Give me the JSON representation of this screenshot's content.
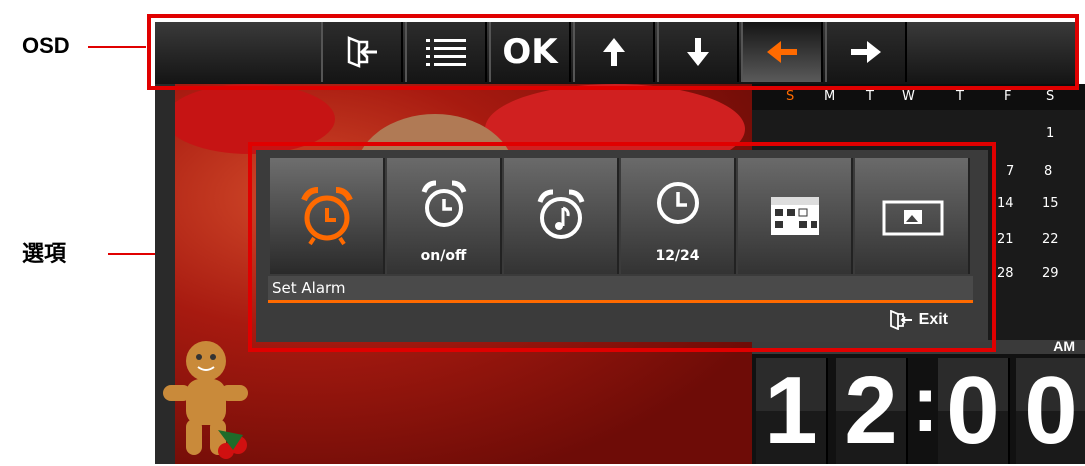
{
  "annotations": {
    "osd": "OSD",
    "options": "選項"
  },
  "osd": {
    "buttons": [
      {
        "name": "exit-icon",
        "glyph": "⇦"
      },
      {
        "name": "menu-list-icon",
        "glyph": "☰"
      },
      {
        "name": "ok",
        "label": "OK"
      },
      {
        "name": "arrow-up-icon",
        "glyph": "↑"
      },
      {
        "name": "arrow-down-icon",
        "glyph": "↓"
      },
      {
        "name": "arrow-left-icon",
        "glyph": "←",
        "active": true
      },
      {
        "name": "arrow-right-icon",
        "glyph": "→"
      }
    ],
    "ok_label": "OK"
  },
  "calendar": {
    "weekdays": [
      "S",
      "M",
      "T",
      "W",
      "T",
      "F",
      "S"
    ],
    "days": [
      "1",
      "7",
      "8",
      "14",
      "15",
      "21",
      "22",
      "28",
      "29"
    ],
    "period": "AM"
  },
  "clock": {
    "digits": [
      "1",
      "2",
      "0",
      "0"
    ],
    "separator": ":"
  },
  "options_menu": {
    "items": [
      {
        "name": "set-alarm",
        "sub": "",
        "active": true
      },
      {
        "name": "alarm-on-off",
        "sub": "on/off"
      },
      {
        "name": "alarm-sound",
        "sub": ""
      },
      {
        "name": "clock-format",
        "sub": "12/24"
      },
      {
        "name": "calendar",
        "sub": ""
      },
      {
        "name": "photo",
        "sub": ""
      }
    ],
    "selected_label": "Set Alarm",
    "exit_label": "Exit"
  },
  "colors": {
    "accent": "#ff6a00",
    "frame": "#e00000"
  }
}
